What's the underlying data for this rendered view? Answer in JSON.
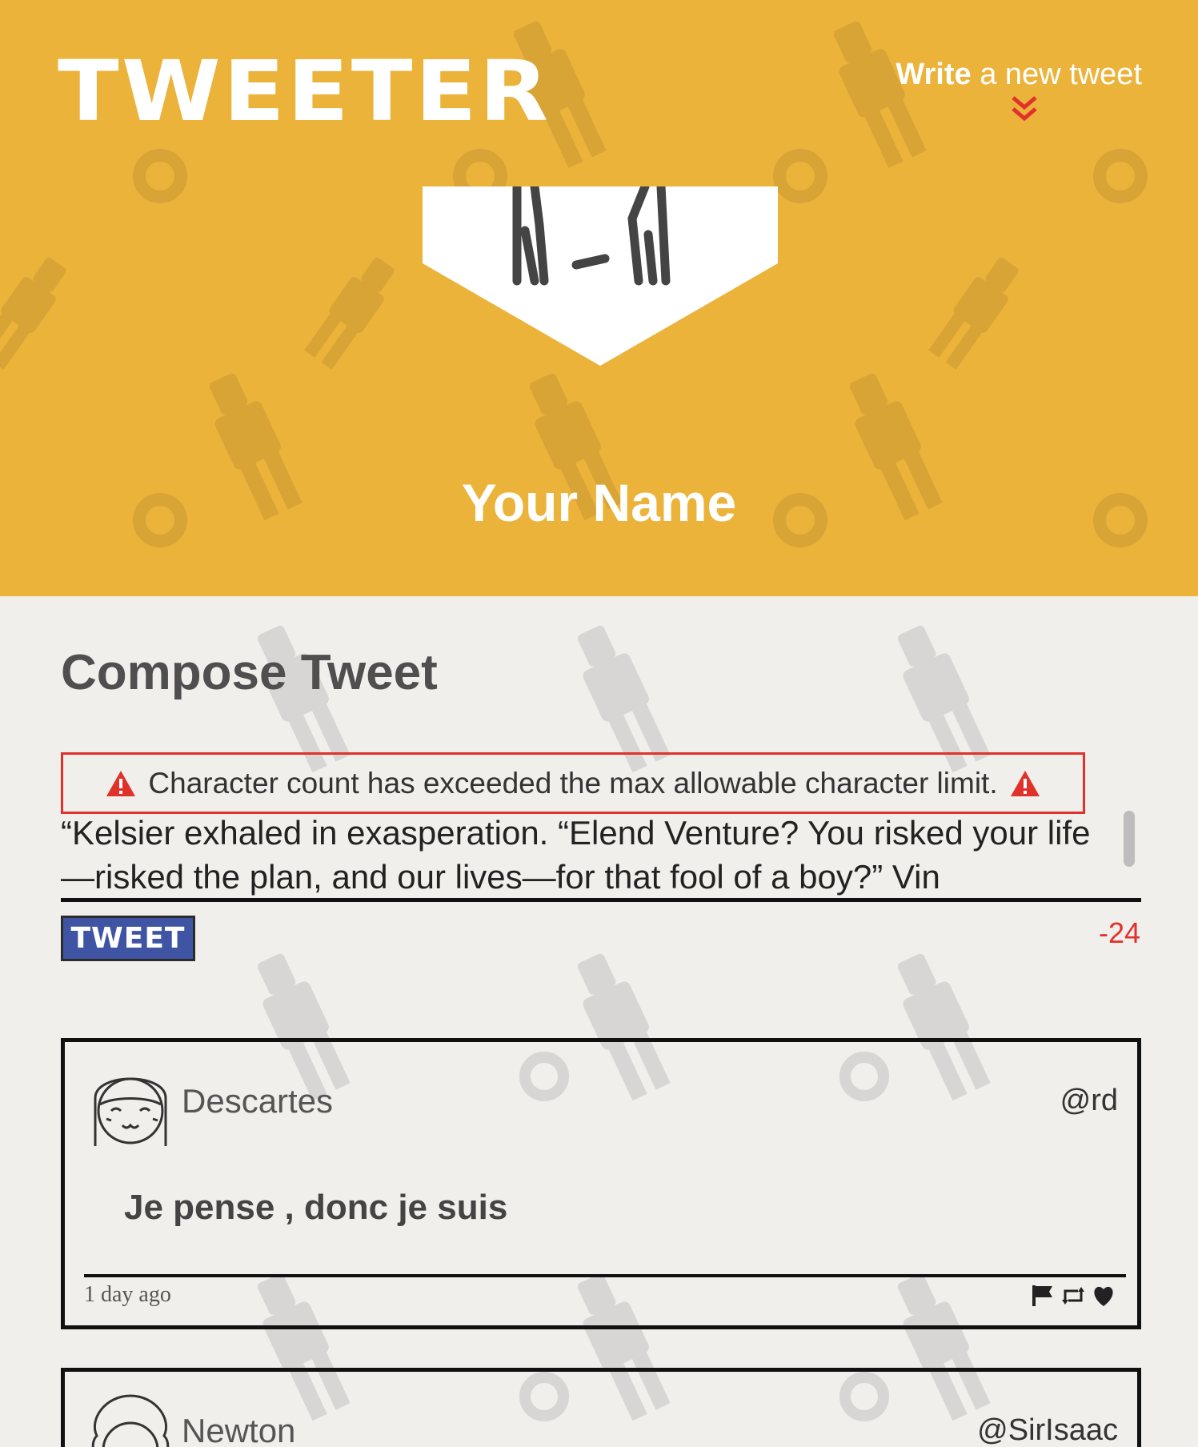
{
  "header": {
    "logo": "TWEETER",
    "write_strong": "Write",
    "write_rest": " a new tweet",
    "user_name": "Your Name"
  },
  "compose": {
    "title": "Compose Tweet",
    "error_message": "Character count has exceeded the max allowable character limit.",
    "textarea_value": "“Kelsier exhaled in exasperation. “Elend Venture? You risked your life—risked the plan, and our lives—for that fool of a boy?” Vin",
    "tweet_button": "TWEET",
    "char_counter": "-24"
  },
  "tweets": [
    {
      "user": "Descartes",
      "handle": "@rd",
      "content": "Je pense , donc je suis",
      "time": "1 day ago",
      "actions": [
        "flag-icon",
        "retweet-icon",
        "heart-icon"
      ]
    },
    {
      "user": "Newton",
      "handle": "@SirIsaac"
    }
  ],
  "colors": {
    "header_bg": "#ecb33b",
    "main_bg": "#f1efeb",
    "error_red": "#e1312b",
    "tweet_button_bg": "#3f55a3"
  }
}
